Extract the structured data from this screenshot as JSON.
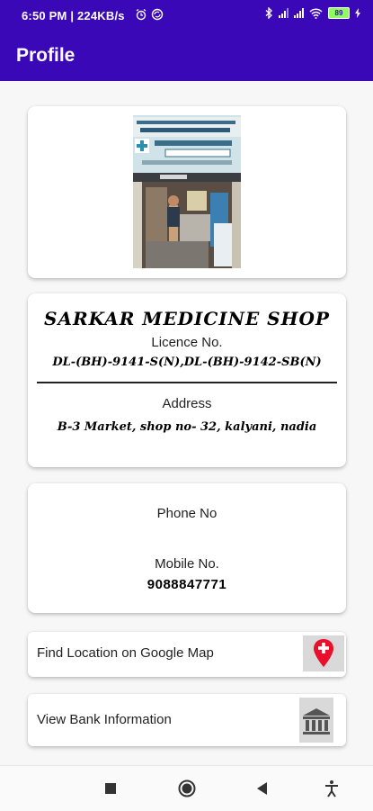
{
  "status_bar": {
    "time": "6:50 PM",
    "speed": "224KB/s",
    "battery": "89",
    "icons": [
      "alarm-icon",
      "sync-icon",
      "bluetooth-icon",
      "signal-icon",
      "signal-icon",
      "wifi-icon",
      "battery-icon",
      "charging-icon"
    ]
  },
  "app_bar": {
    "title": "Profile"
  },
  "shop": {
    "name": "SARKAR MEDICINE SHOP",
    "licence_label": "Licence No.",
    "licence_value": "DL-(BH)-9141-S(N),DL-(BH)-9142-SB(N)",
    "address_label": "Address",
    "address_value": "B-3 Market, shop no- 32, kalyani, nadia"
  },
  "contact": {
    "phone_label": "Phone No",
    "mobile_label": "Mobile No.",
    "mobile_value": "9088847771"
  },
  "actions": {
    "map_label": "Find Location on Google Map",
    "bank_label": "View Bank Information"
  },
  "nav": [
    "recents-square-icon",
    "home-circle-icon",
    "back-triangle-icon",
    "accessibility-icon"
  ],
  "colors": {
    "primary": "#3b08b8",
    "map_pin": "#e8102a"
  }
}
